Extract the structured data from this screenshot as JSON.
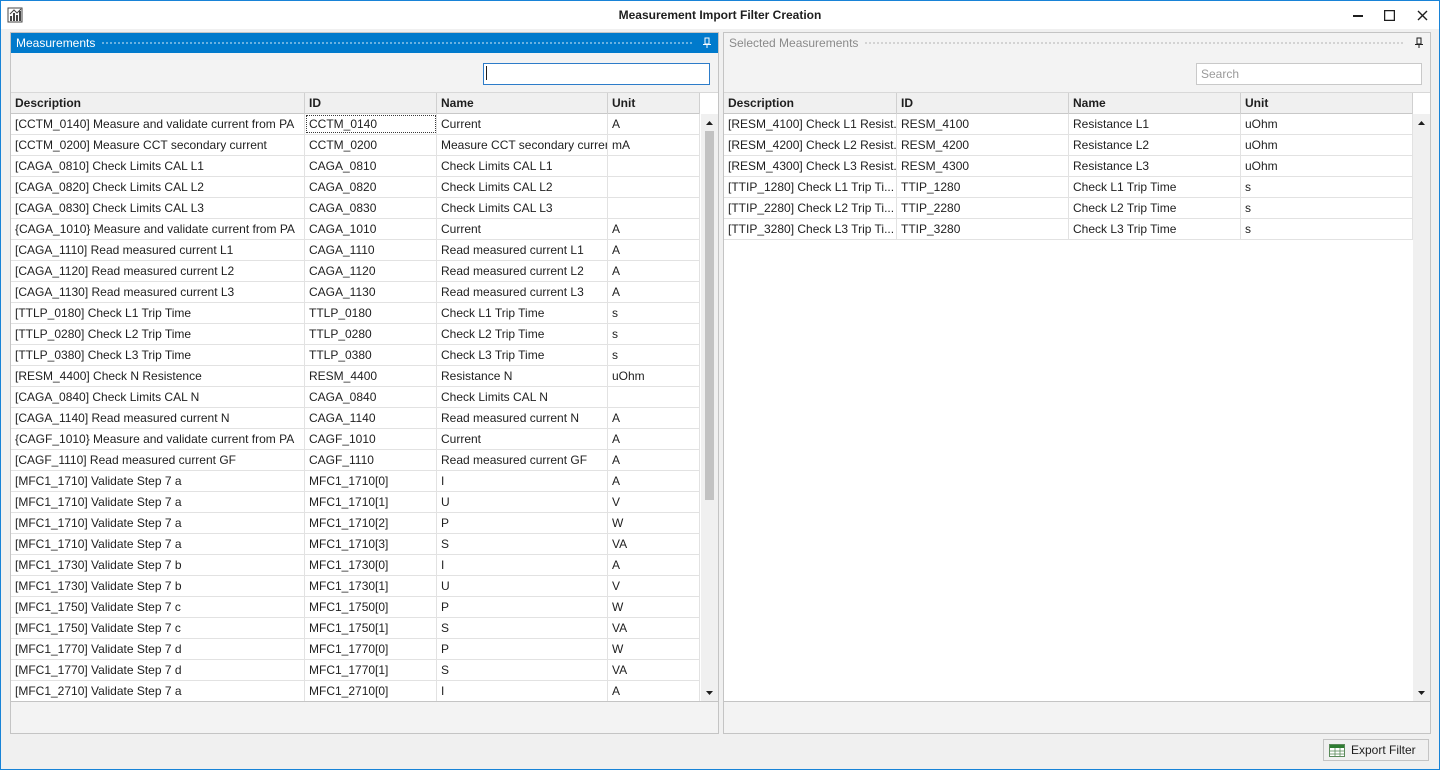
{
  "window": {
    "title": "Measurement Import Filter Creation"
  },
  "left_panel": {
    "title": "Measurements",
    "search_value": "",
    "columns": [
      "Description",
      "ID",
      "Name",
      "Unit"
    ],
    "rows": [
      [
        "[CCTM_0140] Measure and validate current from PA",
        "CCTM_0140",
        "Current",
        "A"
      ],
      [
        "[CCTM_0200] Measure CCT secondary current",
        "CCTM_0200",
        "Measure CCT secondary current",
        "mA"
      ],
      [
        "[CAGA_0810] Check Limits CAL L1",
        "CAGA_0810",
        "Check Limits CAL L1",
        ""
      ],
      [
        "[CAGA_0820] Check Limits CAL L2",
        "CAGA_0820",
        "Check Limits CAL L2",
        ""
      ],
      [
        "[CAGA_0830] Check Limits CAL L3",
        "CAGA_0830",
        "Check Limits CAL L3",
        ""
      ],
      [
        "{CAGA_1010} Measure and validate current from PA",
        "CAGA_1010",
        "Current",
        "A"
      ],
      [
        "[CAGA_1110] Read measured current L1",
        "CAGA_1110",
        "Read measured current L1",
        "A"
      ],
      [
        "[CAGA_1120] Read measured current L2",
        "CAGA_1120",
        "Read measured current L2",
        "A"
      ],
      [
        "[CAGA_1130] Read measured current L3",
        "CAGA_1130",
        "Read measured current L3",
        "A"
      ],
      [
        "[TTLP_0180] Check L1 Trip Time",
        "TTLP_0180",
        "Check L1 Trip Time",
        "s"
      ],
      [
        "[TTLP_0280] Check L2 Trip Time",
        "TTLP_0280",
        "Check L2 Trip Time",
        "s"
      ],
      [
        "[TTLP_0380] Check L3 Trip Time",
        "TTLP_0380",
        "Check L3 Trip Time",
        "s"
      ],
      [
        "[RESM_4400] Check N Resistence",
        "RESM_4400",
        "Resistance N",
        "uOhm"
      ],
      [
        "[CAGA_0840] Check Limits CAL N",
        "CAGA_0840",
        "Check Limits CAL N",
        ""
      ],
      [
        "[CAGA_1140] Read measured current N",
        "CAGA_1140",
        "Read measured current N",
        "A"
      ],
      [
        "{CAGF_1010} Measure and validate current from PA",
        "CAGF_1010",
        "Current",
        "A"
      ],
      [
        "[CAGF_1110] Read measured current GF",
        "CAGF_1110",
        "Read measured current GF",
        "A"
      ],
      [
        "[MFC1_1710] Validate Step 7 a",
        "MFC1_1710[0]",
        "I",
        "A"
      ],
      [
        "[MFC1_1710] Validate Step 7 a",
        "MFC1_1710[1]",
        "U",
        "V"
      ],
      [
        "[MFC1_1710] Validate Step 7 a",
        "MFC1_1710[2]",
        "P",
        "W"
      ],
      [
        "[MFC1_1710] Validate Step 7 a",
        "MFC1_1710[3]",
        "S",
        "VA"
      ],
      [
        "[MFC1_1730] Validate Step 7 b",
        "MFC1_1730[0]",
        "I",
        "A"
      ],
      [
        "[MFC1_1730] Validate Step 7 b",
        "MFC1_1730[1]",
        "U",
        "V"
      ],
      [
        "[MFC1_1750] Validate Step 7 c",
        "MFC1_1750[0]",
        "P",
        "W"
      ],
      [
        "[MFC1_1750] Validate Step 7 c",
        "MFC1_1750[1]",
        "S",
        "VA"
      ],
      [
        "[MFC1_1770] Validate Step 7 d",
        "MFC1_1770[0]",
        "P",
        "W"
      ],
      [
        "[MFC1_1770] Validate Step 7 d",
        "MFC1_1770[1]",
        "S",
        "VA"
      ],
      [
        "[MFC1_2710] Validate Step 7 a",
        "MFC1_2710[0]",
        "I",
        "A"
      ]
    ]
  },
  "right_panel": {
    "title": "Selected Measurements",
    "search_placeholder": "Search",
    "columns": [
      "Description",
      "ID",
      "Name",
      "Unit"
    ],
    "rows": [
      [
        "[RESM_4100] Check L1 Resist...",
        "RESM_4100",
        "Resistance L1",
        "uOhm"
      ],
      [
        "[RESM_4200] Check L2 Resist...",
        "RESM_4200",
        "Resistance L2",
        "uOhm"
      ],
      [
        "[RESM_4300] Check L3 Resist...",
        "RESM_4300",
        "Resistance L3",
        "uOhm"
      ],
      [
        "[TTIP_1280] Check L1 Trip Ti...",
        "TTIP_1280",
        "Check L1 Trip Time",
        "s"
      ],
      [
        "[TTIP_2280] Check L2 Trip Ti...",
        "TTIP_2280",
        "Check L2 Trip Time",
        "s"
      ],
      [
        "[TTIP_3280] Check L3 Trip Ti...",
        "TTIP_3280",
        "Check L3 Trip Time",
        "s"
      ]
    ]
  },
  "export_button": {
    "label": "Export Filter"
  }
}
